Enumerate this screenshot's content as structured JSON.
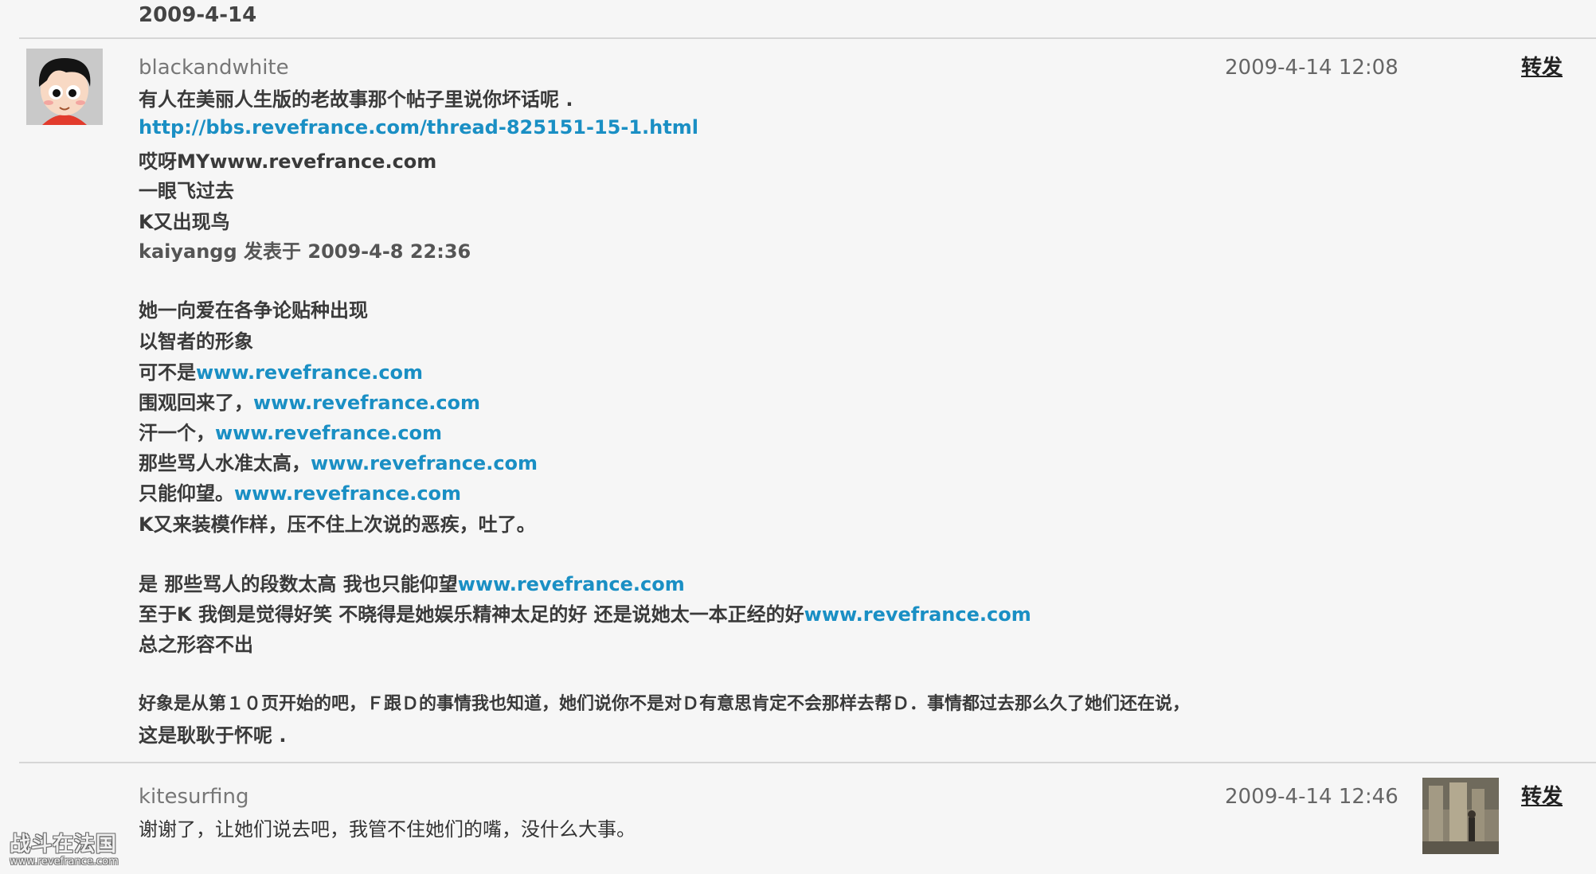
{
  "date_header": "2009-4-14",
  "posts": [
    {
      "username": "blackandwhite",
      "timestamp": "2009-4-14 12:08",
      "forward_label": "转发",
      "lines": [
        {
          "text": "有人在美丽人生版的老故事那个帖子里说你坏话呢 .",
          "link": ""
        },
        {
          "text": "",
          "link": "http://bbs.revefrance.com/thread-825151-15-1.html"
        },
        {
          "text": "哎呀MYwww.revefrance.com",
          "link": ""
        },
        {
          "text": "一眼飞过去",
          "link": ""
        },
        {
          "text": "K又出现鸟",
          "link": ""
        },
        {
          "text": "kaiyangg 发表于  2009-4-8 22:36",
          "link": ""
        },
        {
          "text": "她一向爱在各争论贴种出现",
          "link": ""
        },
        {
          "text": "以智者的形象",
          "link": ""
        },
        {
          "text": "可不是",
          "link": "www.revefrance.com"
        },
        {
          "text": "围观回来了，",
          "link": "www.revefrance.com"
        },
        {
          "text": "汗一个，",
          "link": "www.revefrance.com"
        },
        {
          "text": "那些骂人水准太高，",
          "link": "www.revefrance.com"
        },
        {
          "text": "只能仰望。",
          "link": "www.revefrance.com"
        },
        {
          "text": "K又来装模作样，压不住上次说的恶疾，吐了。",
          "link": ""
        },
        {
          "text": "是  那些骂人的段数太高  我也只能仰望",
          "link": "www.revefrance.com"
        },
        {
          "text": "至于K 我倒是觉得好笑  不晓得是她娱乐精神太足的好  还是说她太一本正经的好",
          "link": "www.revefrance.com"
        },
        {
          "text": "总之形容不出",
          "link": ""
        },
        {
          "text": "好象是从第１０页开始的吧，Ｆ跟Ｄ的事情我也知道，她们说你不是对Ｄ有意思肯定不会那样去帮Ｄ．事情都过去那么久了她们还在说，",
          "link": ""
        },
        {
          "text": "这是耿耿于怀呢 .",
          "link": ""
        }
      ]
    },
    {
      "username": "kitesurfing",
      "timestamp": "2009-4-14 12:46",
      "forward_label": "转发",
      "lines": [
        {
          "text": "谢谢了，让她们说去吧，我管不住她们的嘴，没什么大事。",
          "link": ""
        }
      ]
    }
  ],
  "watermark": {
    "title": "战斗在法国",
    "url": "www.revefrance.com"
  }
}
